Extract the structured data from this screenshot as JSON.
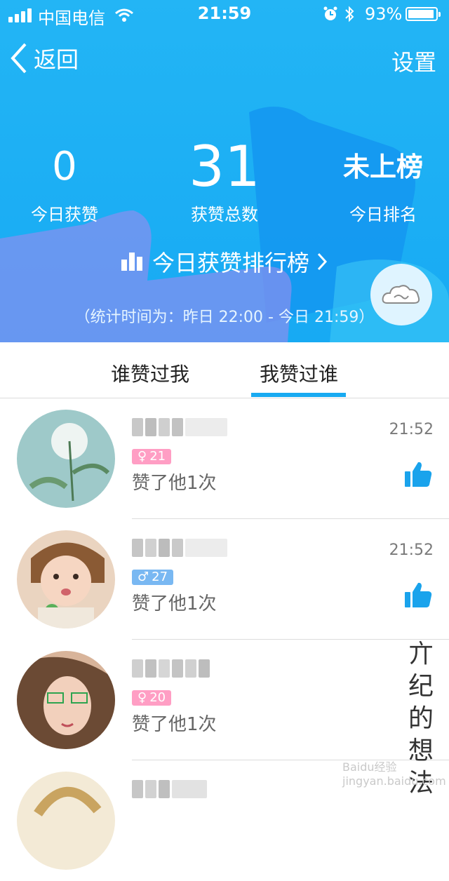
{
  "status_bar": {
    "carrier": "中国电信",
    "time": "21:59",
    "battery_percent": "93%",
    "battery_level": 0.93,
    "signal_bars": 4
  },
  "nav": {
    "back_label": "返回",
    "settings_label": "设置"
  },
  "stats": {
    "today_likes": {
      "value": "0",
      "label": "今日获赞"
    },
    "total_likes": {
      "value": "31",
      "label": "获赞总数"
    },
    "today_rank": {
      "value": "未上榜",
      "label": "今日排名"
    }
  },
  "leaderboard_link": {
    "label": "今日获赞排行榜"
  },
  "stats_period": "（统计时间为：昨日 22:00 - 今日 21:59）",
  "tabs": [
    {
      "label": "谁赞过我",
      "active": false
    },
    {
      "label": "我赞过谁",
      "active": true
    }
  ],
  "colors": {
    "header_blue": "#19acf4",
    "accent": "#18aaf1",
    "like_icon": "#1aa3ec",
    "female_badge": "#ff9ec4",
    "male_badge": "#79b8f2"
  },
  "likes_list": [
    {
      "gender_symbol": "♀",
      "age": "21",
      "gender": "female",
      "action": "赞了他1次",
      "time": "21:52"
    },
    {
      "gender_symbol": "♂",
      "age": "27",
      "gender": "male",
      "action": "赞了他1次",
      "time": "21:52"
    },
    {
      "gender_symbol": "♀",
      "age": "20",
      "gender": "female",
      "action": "赞了他1次",
      "time": ""
    }
  ],
  "watermark": {
    "lines": [
      "亣",
      "纪",
      "的",
      "想",
      "法"
    ],
    "site": "Baidu经验 jingyan.baidu.com"
  }
}
